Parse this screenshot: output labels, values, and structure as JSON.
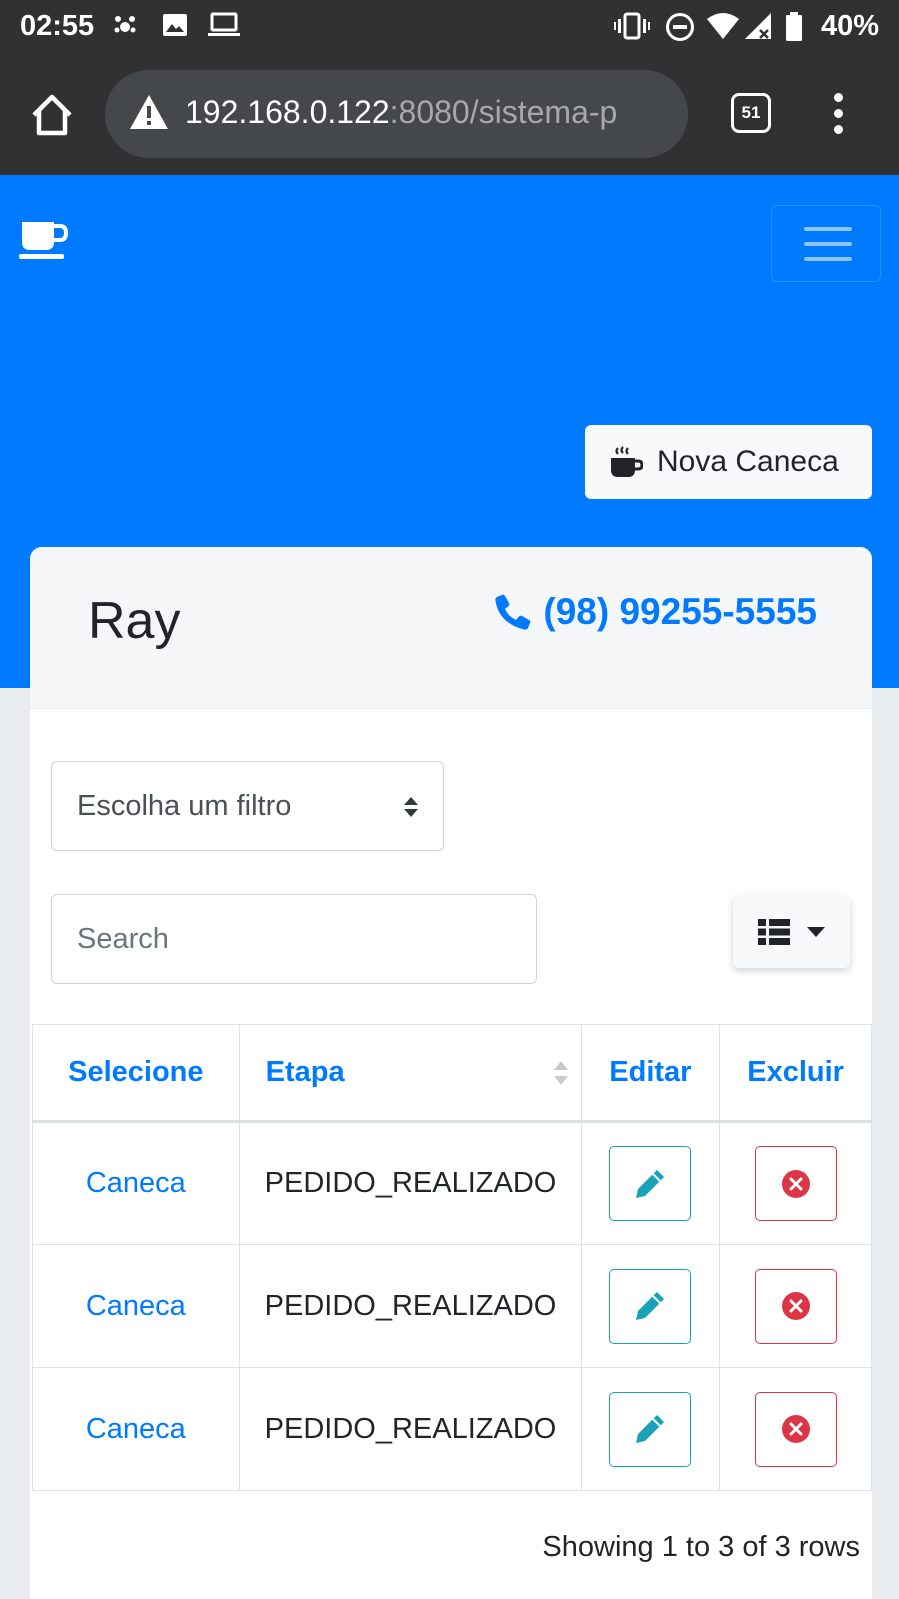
{
  "status_bar": {
    "time": "02:55",
    "battery": "40%"
  },
  "browser": {
    "url_host": "192.168.0.122",
    "url_rest": ":8080/sistema-p",
    "tab_count": "51"
  },
  "navbar": {
    "brand_icon": "coffee-cup-icon",
    "toggler_icon": "hamburger-icon"
  },
  "actions": {
    "new_button_label": "Nova Caneca"
  },
  "client": {
    "name": "Ray",
    "phone": "(98) 99255-5555"
  },
  "filters": {
    "select_value": "Escolha um filtro",
    "search_placeholder": "Search"
  },
  "table": {
    "headers": [
      "Selecione",
      "Etapa",
      "Editar",
      "Excluir"
    ],
    "rows": [
      {
        "select": "Caneca",
        "etapa": "PEDIDO_REALIZADO"
      },
      {
        "select": "Caneca",
        "etapa": "PEDIDO_REALIZADO"
      },
      {
        "select": "Caneca",
        "etapa": "PEDIDO_REALIZADO"
      }
    ],
    "footer": "Showing 1 to 3 of 3 rows"
  },
  "colors": {
    "primary": "#007bff",
    "info": "#17a2b8",
    "danger": "#dc3545",
    "chrome": "#2f3133"
  }
}
